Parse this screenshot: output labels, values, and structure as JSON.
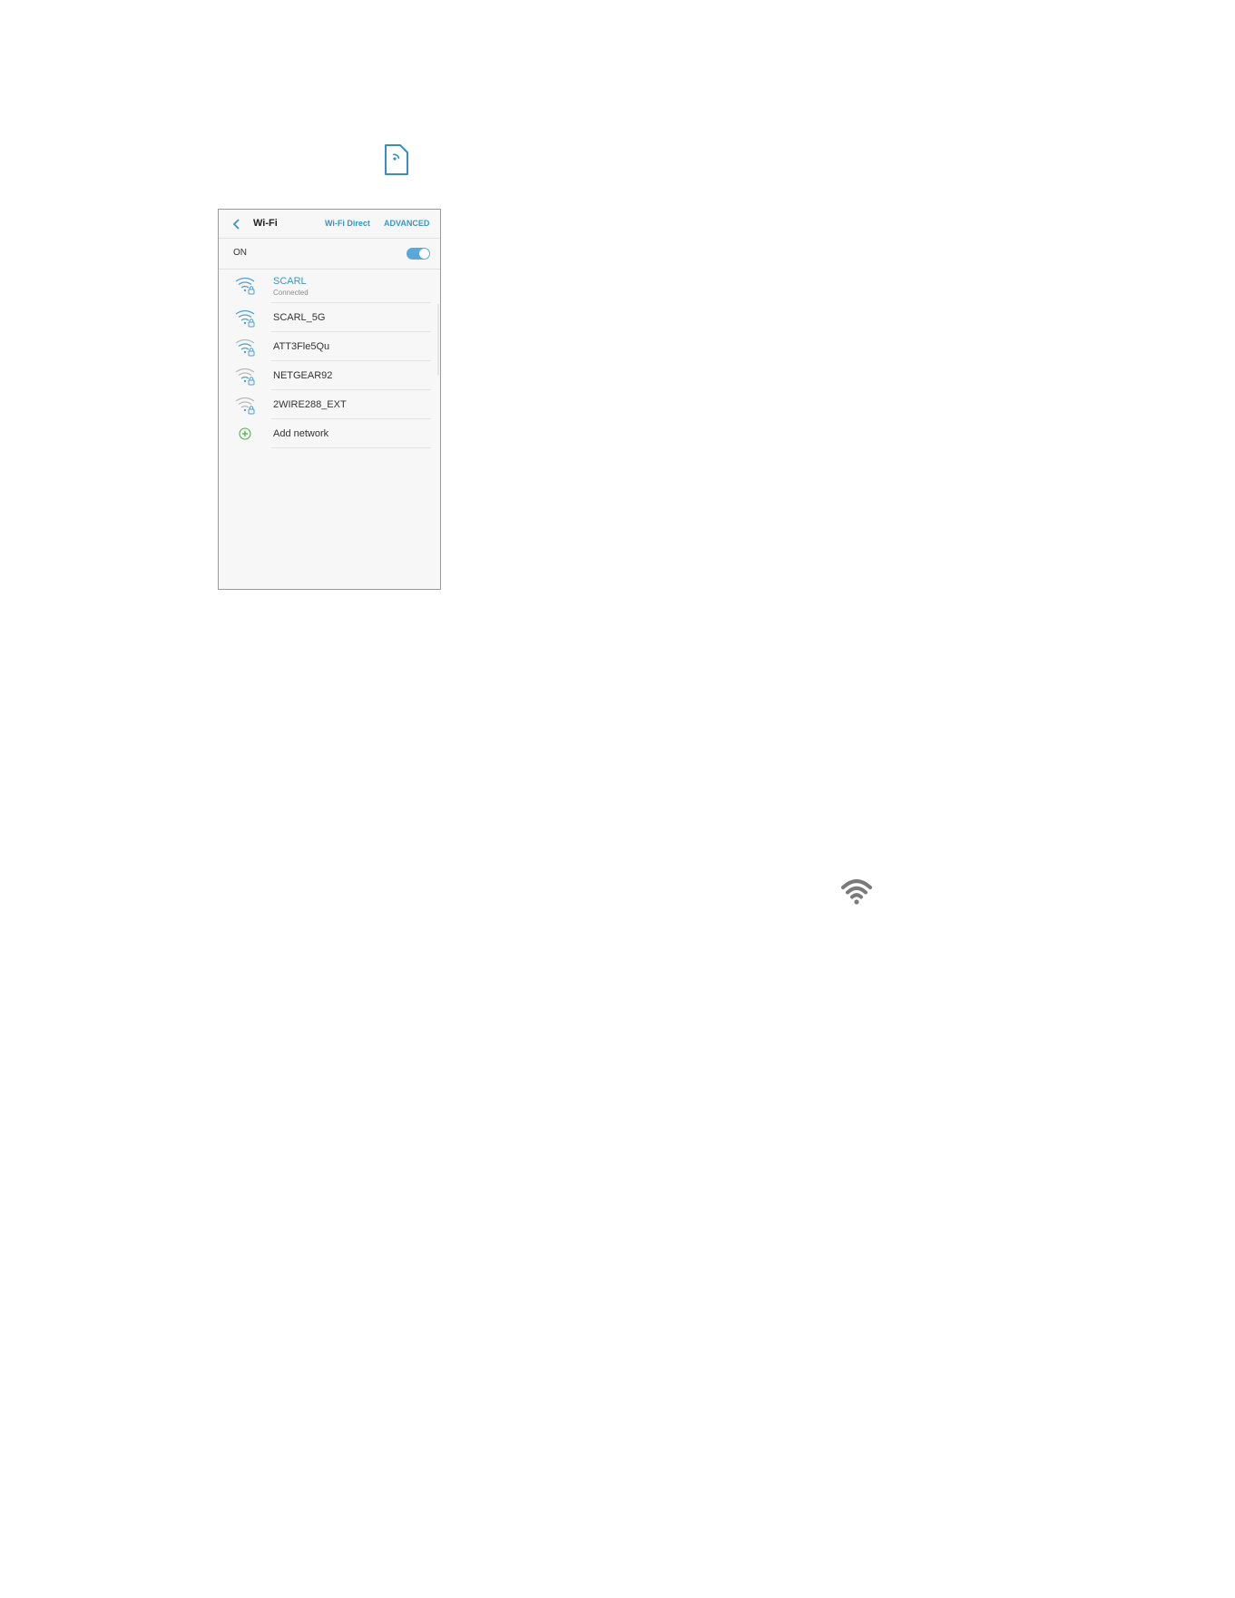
{
  "header": {
    "back_icon": "chevron-left-icon",
    "title": "Wi-Fi",
    "wifi_direct": "Wi-Fi Direct",
    "advanced": "ADVANCED"
  },
  "toggle": {
    "label": "ON",
    "state": true
  },
  "networks": [
    {
      "name": "SCARL",
      "status": "Connected",
      "connected": true
    },
    {
      "name": "SCARL_5G",
      "status": "",
      "connected": false
    },
    {
      "name": "ATT3Fle5Qu",
      "status": "",
      "connected": false
    },
    {
      "name": "NETGEAR92",
      "status": "",
      "connected": false
    },
    {
      "name": "2WIRE288_EXT",
      "status": "",
      "connected": false
    }
  ],
  "add_network": {
    "label": "Add network",
    "icon": "plus-circle-icon"
  },
  "colors": {
    "accent": "#3a95c6",
    "toggle": "#5aa8da",
    "add_green": "#4caf50",
    "icon_gray": "#777777"
  },
  "floating_icons": [
    "phone-wireless-icon",
    "wifi-signal-icon"
  ]
}
